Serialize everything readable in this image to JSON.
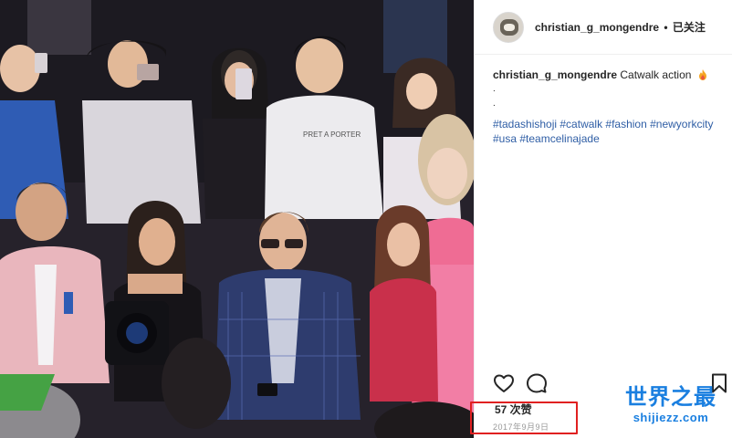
{
  "post": {
    "header": {
      "username": "christian_g_mongendre",
      "separator": "•",
      "follow_status": "已关注"
    },
    "caption": {
      "username": "christian_g_mongendre",
      "text": "Catwalk action",
      "emoji_icon": "fire-emoji-icon",
      "dot_line_1": ".",
      "dot_line_2": ".",
      "hashtags_line_1": "#tadashishoji #catwalk #fashion #newyorkcity",
      "hashtags_line_2": "#usa #teamcelinajade"
    },
    "actions": {
      "like_icon": "heart-icon",
      "comment_icon": "comment-icon",
      "save_icon": "bookmark-icon"
    },
    "likes": "57 次赞",
    "date": "2017年9月9日"
  },
  "watermark": {
    "title": "世界之最",
    "url": "shijiezz.com"
  },
  "colors": {
    "hashtag": "#2f5ea5",
    "highlight_box": "#e02020",
    "watermark": "#1a7fe0"
  }
}
